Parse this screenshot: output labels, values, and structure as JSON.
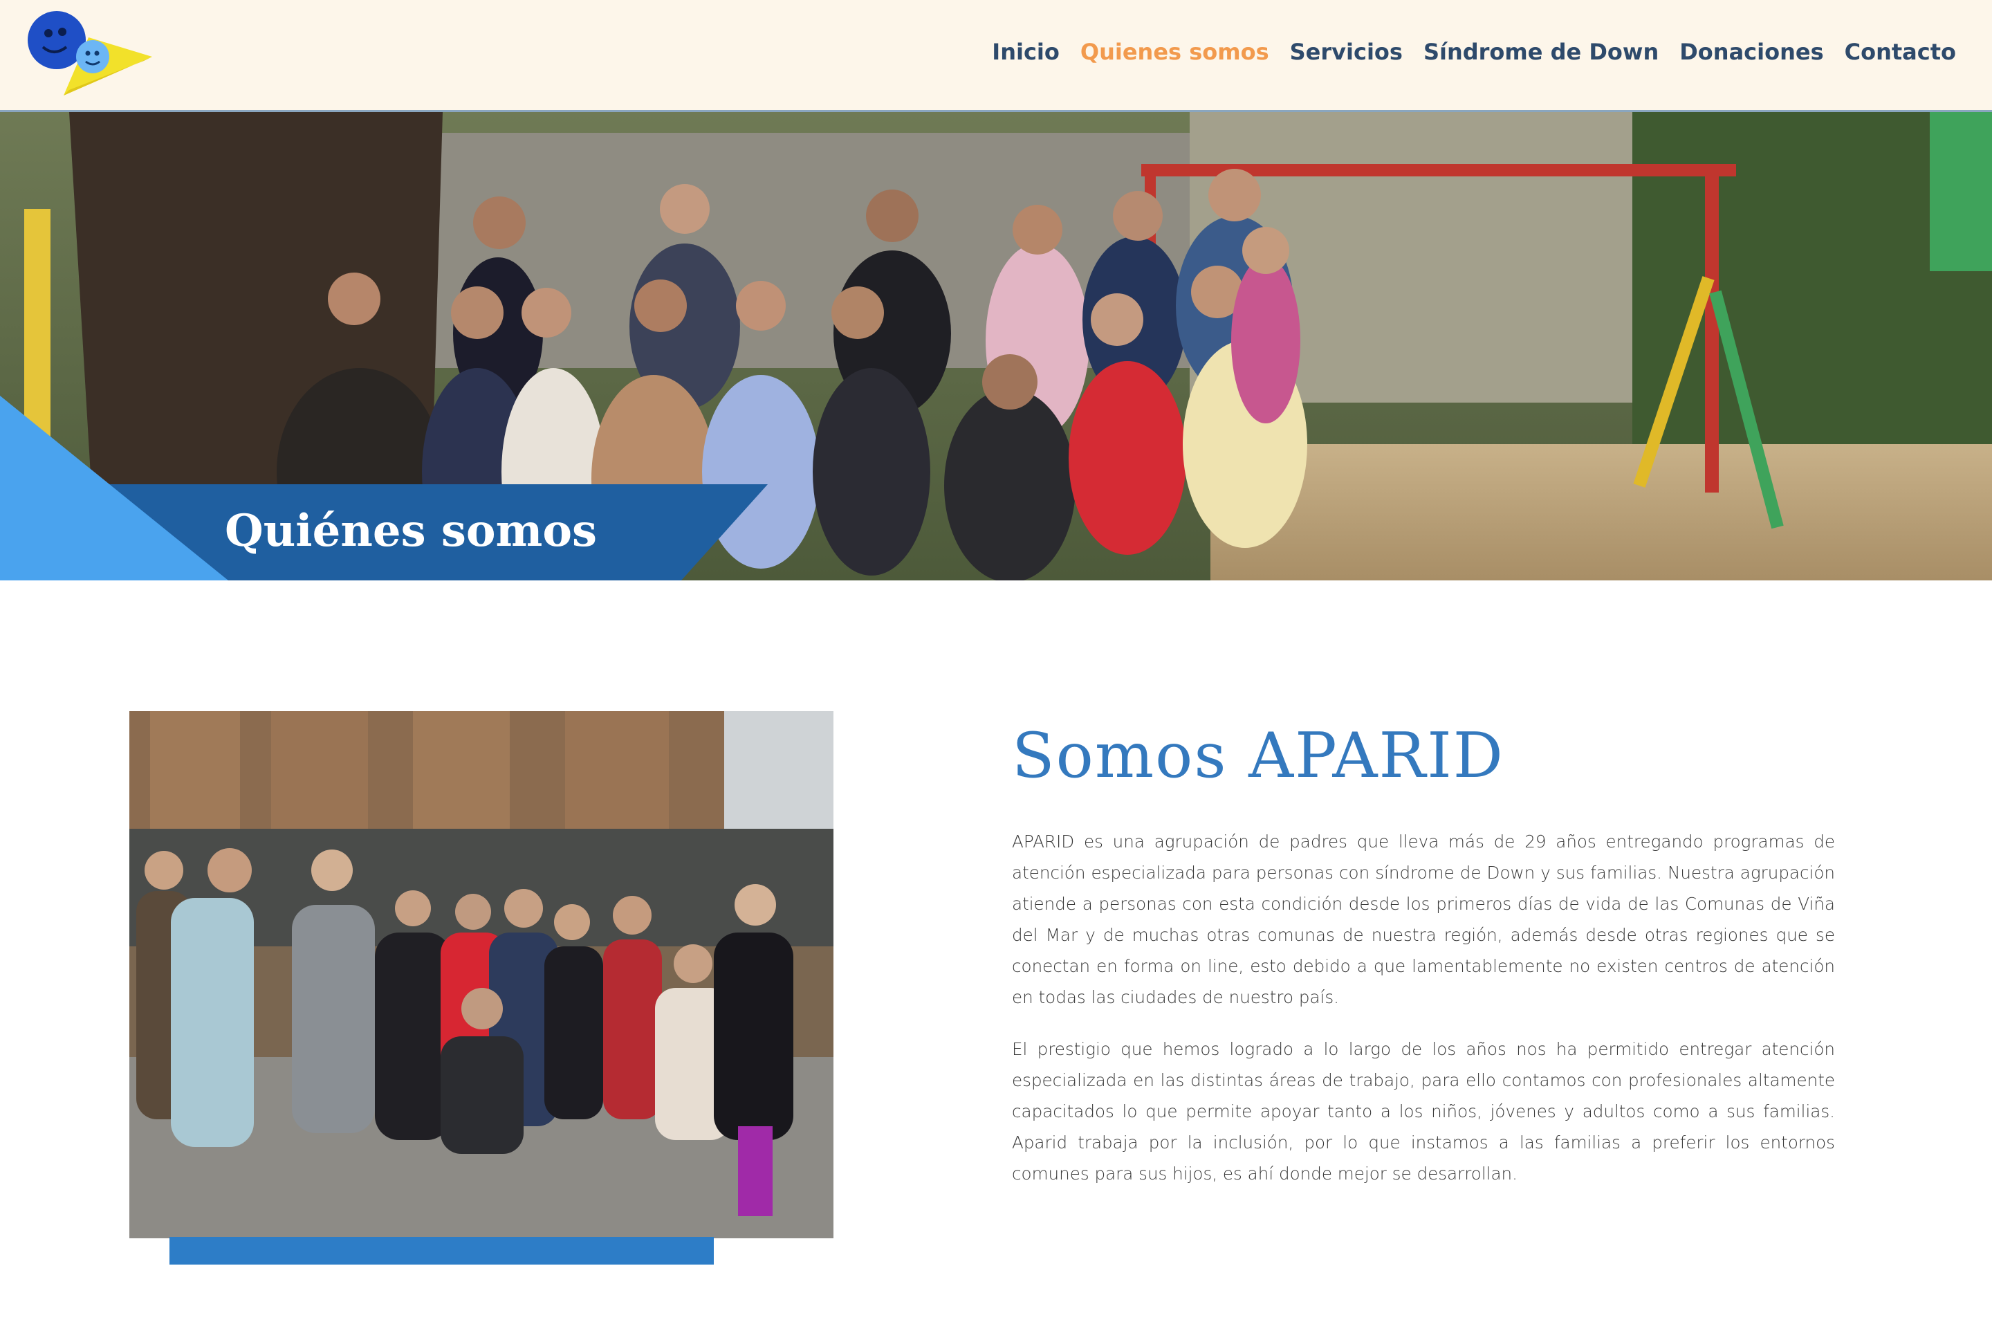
{
  "header": {
    "logo_alt": "APARID logo",
    "nav": [
      {
        "label": "Inicio",
        "active": false
      },
      {
        "label": "Quienes somos",
        "active": true
      },
      {
        "label": "Servicios",
        "active": false
      },
      {
        "label": "Síndrome de Down",
        "active": false
      },
      {
        "label": "Donaciones",
        "active": false
      },
      {
        "label": "Contacto",
        "active": false
      }
    ]
  },
  "hero": {
    "title": "Quiénes somos",
    "image_description": "group-photo-outdoor-playground"
  },
  "about": {
    "title": "Somos APARID",
    "paragraph_1": "APARID es una agrupación de padres que lleva más de 29 años entregando programas de atención especializada para personas con síndrome de Down y sus familias. Nuestra agrupación atiende a personas con esta condición desde los primeros días de vida de las Comunas de Viña del Mar y de muchas otras comunas de nuestra región, además desde otras regiones que se conectan en forma on line, esto debido a que lamentablemente no existen centros de atención en todas las ciudades de nuestro país.",
    "paragraph_2": "El prestigio que hemos logrado a lo largo de los años nos ha permitido entregar atención especializada en las distintas áreas de trabajo, para ello contamos con profesionales altamente capacitados lo que permite apoyar tanto a los niños, jóvenes y adultos como a sus familias. Aparid trabaja por la inclusión, por lo que instamos a las familias a preferir los entornos comunes para sus hijos, es ahí donde mejor se desarrollan.",
    "photo_description": "group-photo-building-entrance"
  },
  "colors": {
    "header_bg": "#fdf6ea",
    "nav_text": "#2e4a6b",
    "nav_active": "#f29a4d",
    "brand_blue": "#2d7dc7",
    "title_blue": "#3479be",
    "hero_band_light": "#4aa3ee",
    "hero_band_dark": "#1f5fa0"
  }
}
